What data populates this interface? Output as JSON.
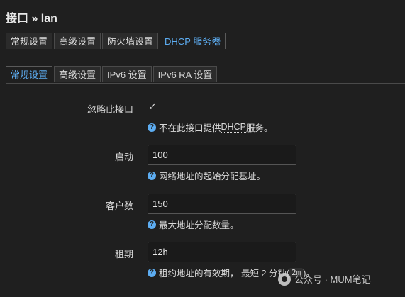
{
  "page": {
    "title": "接口 » lan"
  },
  "main_tabs": [
    {
      "label": "常规设置",
      "active": false
    },
    {
      "label": "高级设置",
      "active": false
    },
    {
      "label": "防火墙设置",
      "active": false
    },
    {
      "label": "DHCP 服务器",
      "active": true
    }
  ],
  "sub_tabs": [
    {
      "label": "常规设置",
      "active": true
    },
    {
      "label": "高级设置",
      "active": false
    },
    {
      "label": "IPv6 设置",
      "active": false
    },
    {
      "label": "IPv6 RA 设置",
      "active": false
    }
  ],
  "form": {
    "ignore": {
      "label": "忽略此接口",
      "checked": true,
      "help_prefix": "不在此接口提供 ",
      "help_term": "DHCP",
      "help_suffix": " 服务。"
    },
    "start": {
      "label": "启动",
      "value": "100",
      "help": "网络地址的起始分配基址。"
    },
    "limit": {
      "label": "客户数",
      "value": "150",
      "help": "最大地址分配数量。"
    },
    "leasetime": {
      "label": "租期",
      "value": "12h",
      "help_prefix": "租约地址的有效期， 最短 2 分钟(",
      "help_code": "2m",
      "help_suffix": ")。"
    }
  },
  "watermark": {
    "text": "公众号 · MUM笔记"
  },
  "colors": {
    "accent": "#5dadf2",
    "background": "#1f1f1f"
  }
}
